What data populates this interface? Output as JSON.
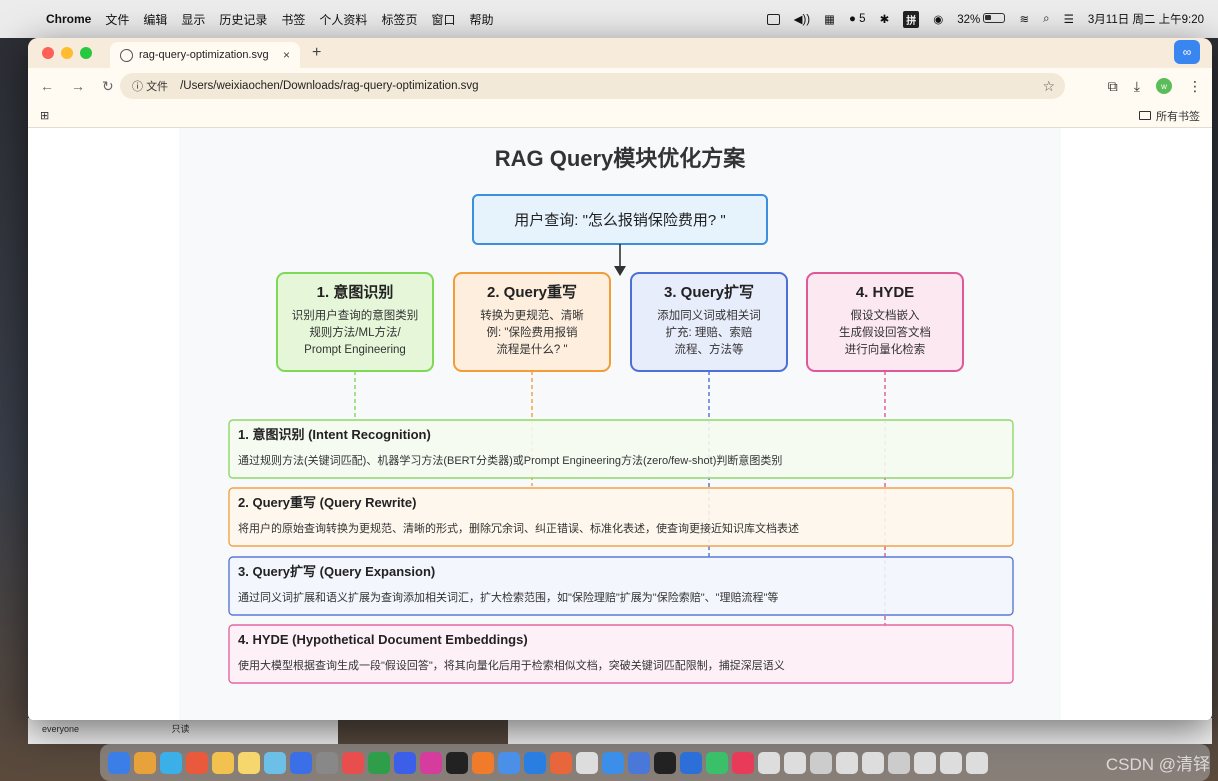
{
  "menubar": {
    "app": "Chrome",
    "items": [
      "文件",
      "编辑",
      "显示",
      "历史记录",
      "书签",
      "个人资料",
      "标签页",
      "窗口",
      "帮助"
    ],
    "wechat_count": "5",
    "ime": "拼",
    "battery": "32%",
    "datetime": "3月11日 周二 上午9:20"
  },
  "browser": {
    "tab_title": "rag-query-optimization.svg",
    "tab_close": "×",
    "new_tab": "+",
    "omnibox_prefix": "文件",
    "url": "/Users/weixiaochen/Downloads/rag-query-optimization.svg",
    "all_bookmarks": "所有书签"
  },
  "diagram": {
    "title": "RAG Query模块优化方案",
    "query": "用户查询: \"怎么报销保险费用? \"",
    "cards": [
      {
        "title": "1. 意图识别",
        "lines": [
          "识别用户查询的意图类别",
          "规则方法/ML方法/",
          "Prompt Engineering"
        ],
        "stroke": "#7ed957",
        "fill": "#e6f7d9"
      },
      {
        "title": "2. Query重写",
        "lines": [
          "转换为更规范、清晰",
          "例: \"保险费用报销",
          "流程是什么? \""
        ],
        "stroke": "#f29d38",
        "fill": "#fdeede"
      },
      {
        "title": "3. Query扩写",
        "lines": [
          "添加同义词或相关词",
          "扩充: 理赔、索赔",
          "流程、方法等"
        ],
        "stroke": "#4d6fd8",
        "fill": "#e8edfb"
      },
      {
        "title": "4. HYDE",
        "lines": [
          "假设文档嵌入",
          "生成假设回答文档",
          "进行向量化检索"
        ],
        "stroke": "#e0579a",
        "fill": "#fce8f1"
      }
    ],
    "details": [
      {
        "title": "1. 意图识别 (Intent Recognition)",
        "text": "通过规则方法(关键词匹配)、机器学习方法(BERT分类器)或Prompt Engineering方法(zero/few-shot)判断意图类别",
        "stroke": "#8fd86a",
        "fill": "#f4fbef"
      },
      {
        "title": "2. Query重写 (Query Rewrite)",
        "text": "将用户的原始查询转换为更规范、清晰的形式，删除冗余词、纠正错误、标准化表述，使查询更接近知识库文档表述",
        "stroke": "#f2a24a",
        "fill": "#fef6ec"
      },
      {
        "title": "3. Query扩写 (Query Expansion)",
        "text": "通过同义词扩展和语义扩展为查询添加相关词汇，扩大检索范围，如\"保险理赔\"扩展为\"保险索赔\"、\"理赔流程\"等",
        "stroke": "#5a78d8",
        "fill": "#f2f5fd"
      },
      {
        "title": "4. HYDE (Hypothetical Document Embeddings)",
        "text": "使用大模型根据查询生成一段\"假设回答\"，将其向量化后用于检索相似文档，突破关键词匹配限制，捕捉深层语义",
        "stroke": "#e466a3",
        "fill": "#fdf0f6"
      }
    ]
  },
  "background": {
    "left_window_text": "everyone",
    "left_window_text2": "只读"
  },
  "watermark": "CSDN @清铎"
}
